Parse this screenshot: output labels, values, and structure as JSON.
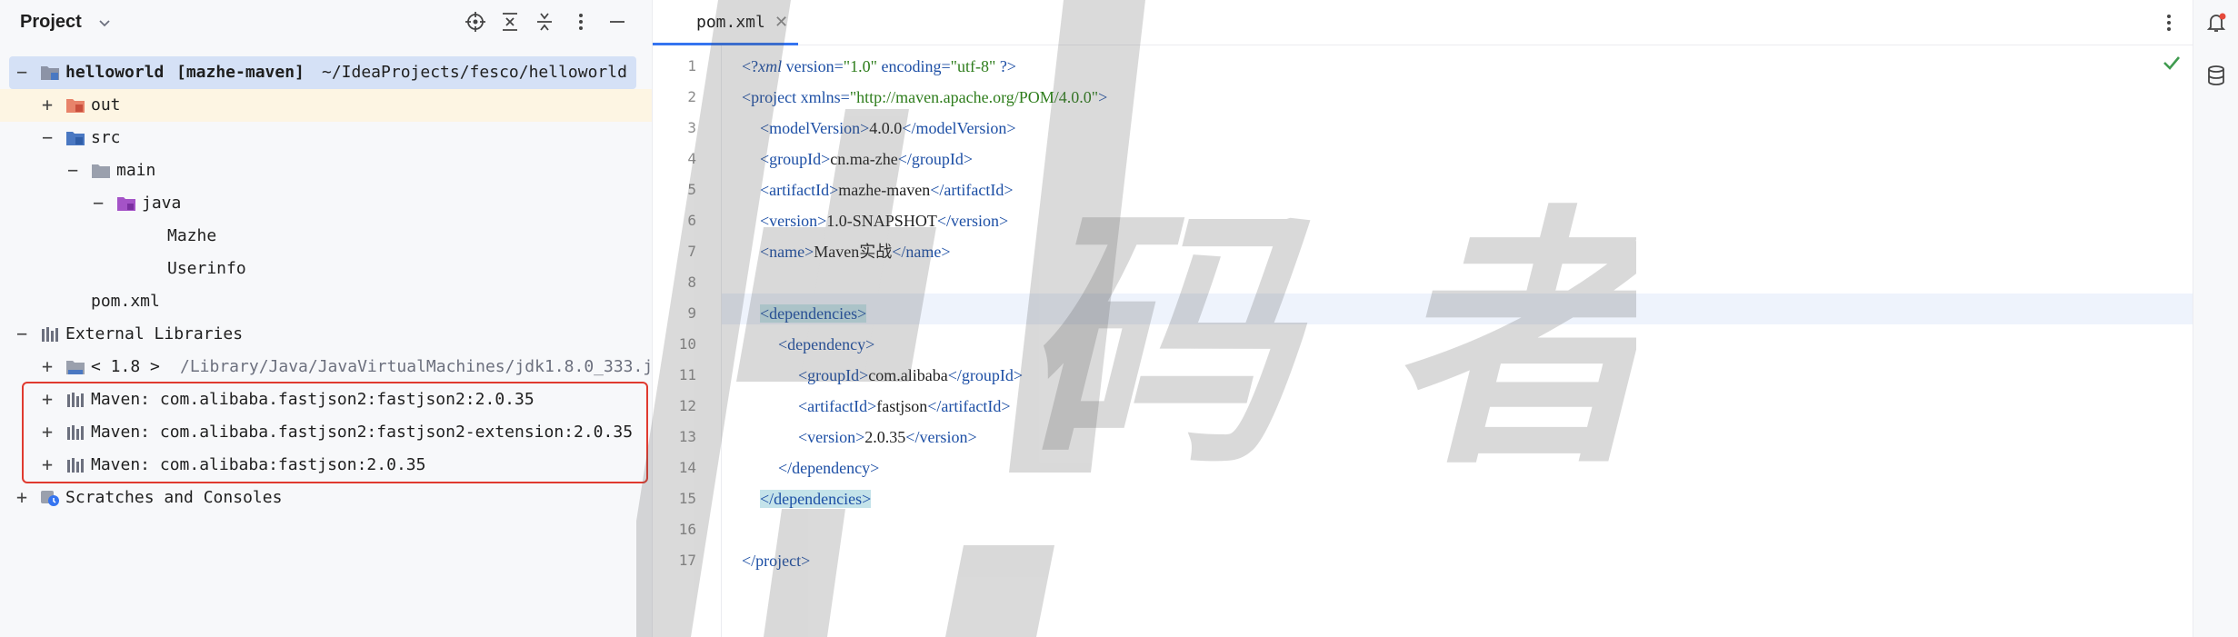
{
  "project_panel": {
    "title": "Project",
    "tree": [
      {
        "name": "helloworld",
        "module": "[mazhe-maven]",
        "path": "~/IdeaProjects/fesco/helloworld",
        "toggle": "−"
      },
      {
        "name": "out",
        "toggle": "+"
      },
      {
        "name": "src",
        "toggle": "−"
      },
      {
        "name": "main",
        "toggle": "−"
      },
      {
        "name": "java",
        "toggle": "−"
      },
      {
        "name": "Mazhe"
      },
      {
        "name": "Userinfo"
      },
      {
        "name": "pom.xml"
      },
      {
        "name": "External Libraries",
        "toggle": "−"
      },
      {
        "name": "< 1.8 >",
        "path": "/Library/Java/JavaVirtualMachines/jdk1.8.0_333.j",
        "toggle": "+"
      },
      {
        "name": "Maven: com.alibaba.fastjson2:fastjson2:2.0.35",
        "toggle": "+"
      },
      {
        "name": "Maven: com.alibaba.fastjson2:fastjson2-extension:2.0.35",
        "toggle": "+"
      },
      {
        "name": "Maven: com.alibaba:fastjson:2.0.35",
        "toggle": "+"
      },
      {
        "name": "Scratches and Consoles",
        "toggle": "+"
      }
    ]
  },
  "editor": {
    "tab_label": "pom.xml",
    "tab_close": "✕",
    "line_numbers": [
      "1",
      "2",
      "3",
      "4",
      "5",
      "6",
      "7",
      "8",
      "9",
      "10",
      "11",
      "12",
      "13",
      "14",
      "15",
      "16",
      "17"
    ],
    "code": {
      "l1": {
        "open": "<?",
        "kw": "xml",
        "a1": " version=",
        "v1": "\"1.0\"",
        "a2": " encoding=",
        "v2": "\"utf-8\"",
        "close": " ?>"
      },
      "l2": {
        "open": "<project",
        "a1": " xmlns=",
        "v1": "\"http://maven.apache.org/POM/4.0.0\"",
        "close": ">"
      },
      "l3": {
        "open": "<modelVersion>",
        "text": "4.0.0",
        "close": "</modelVersion>"
      },
      "l4": {
        "open": "<groupId>",
        "text": "cn.ma-zhe",
        "close": "</groupId>"
      },
      "l5": {
        "open": "<artifactId>",
        "text": "mazhe-maven",
        "close": "</artifactId>"
      },
      "l6": {
        "open": "<version>",
        "text": "1.0-SNAPSHOT",
        "close": "</version>"
      },
      "l7": {
        "open": "<name>",
        "text": "Maven实战",
        "close": "</name>"
      },
      "l9": {
        "open": "<dependencies>"
      },
      "l10": {
        "open": "<dependency>"
      },
      "l11": {
        "open": "<groupId>",
        "text": "com.alibaba",
        "close": "</groupId>"
      },
      "l12": {
        "open": "<artifactId>",
        "text": "fastjson",
        "close": "</artifactId>"
      },
      "l13": {
        "open": "<version>",
        "text": "2.0.35",
        "close": "</version>"
      },
      "l14": {
        "close": "</dependency>"
      },
      "l15": {
        "close": "</dependencies>"
      },
      "l17": {
        "close": "</project>"
      }
    }
  },
  "watermark": {
    "text": "码 者"
  },
  "colors": {
    "selection": "#d5e1f6",
    "highlight_border": "#e03a2f",
    "tag_blue": "#1d4fa5",
    "string_green": "#2e7d1c",
    "accent": "#3574f0"
  },
  "icons": [
    "chevron-down-icon",
    "locate-icon",
    "expand-all-icon",
    "collapse-all-icon",
    "more-vertical-icon",
    "minimize-icon",
    "module-folder-icon",
    "excluded-folder-icon",
    "source-folder-icon",
    "folder-icon",
    "java-folder-icon",
    "library-icon",
    "jdk-icon",
    "scratches-icon",
    "checkmark-icon",
    "notifications-icon",
    "database-icon"
  ]
}
